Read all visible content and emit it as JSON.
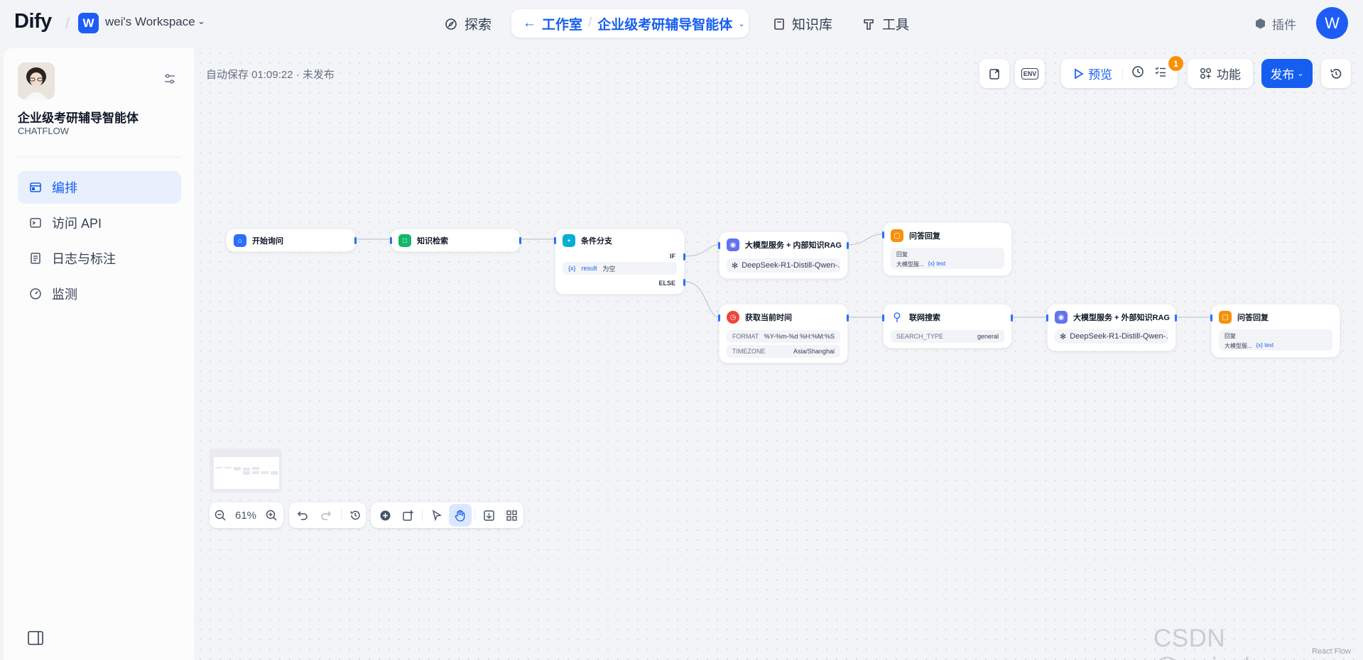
{
  "topbar": {
    "brand": "Dify",
    "workspace_initial": "W",
    "workspace_name": "wei's Workspace",
    "nav_explore": "探索",
    "nav_studio": "工作室",
    "nav_current_app": "企业级考研辅导智能体",
    "nav_knowledge": "知识库",
    "nav_tools": "工具",
    "plugins": "插件",
    "user_initial": "W"
  },
  "sidebar": {
    "app_name": "企业级考研辅导智能体",
    "app_type": "CHATFLOW",
    "items": [
      {
        "label": "编排",
        "icon": "layout-icon",
        "active": true
      },
      {
        "label": "访问 API",
        "icon": "terminal-icon",
        "active": false
      },
      {
        "label": "日志与标注",
        "icon": "log-icon",
        "active": false
      },
      {
        "label": "监测",
        "icon": "gauge-icon",
        "active": false
      }
    ]
  },
  "canvas": {
    "autosave": "自动保存 01:09:22 · 未发布",
    "toolbar": {
      "env_label": "ENV",
      "preview_label": "预览",
      "checklist_count": "1",
      "features_label": "功能",
      "publish_label": "发布"
    },
    "nodes": {
      "start": {
        "title": "开始询问"
      },
      "knowledge": {
        "title": "知识检索"
      },
      "ifelse": {
        "title": "条件分支",
        "if_label": "IF",
        "else_label": "ELSE",
        "cond_var_icon": "{x}",
        "cond_var": "result",
        "cond_op": "为空"
      },
      "llm_internal": {
        "title": "大模型服务 + 内部知识RAG",
        "model": "DeepSeek-R1-Distill-Qwen-..."
      },
      "answer1": {
        "title": "问答回复",
        "label": "回复",
        "source": "大模型服...",
        "var": "{x} text"
      },
      "time": {
        "title": "获取当前时间",
        "format_key": "FORMAT",
        "format_val": "%Y-%m-%d %H:%M:%S",
        "tz_key": "TIMEZONE",
        "tz_val": "Asia/Shanghai"
      },
      "search": {
        "title": "联网搜索",
        "type_key": "SEARCH_TYPE",
        "type_val": "general"
      },
      "llm_external": {
        "title": "大模型服务 + 外部知识RAG",
        "model": "DeepSeek-R1-Distill-Qwen-..."
      },
      "answer2": {
        "title": "问答回复",
        "label": "回复",
        "source": "大模型服...",
        "var": "{x} text"
      }
    },
    "zoom": "61%"
  },
  "watermark": "CSDN @wei_shuo",
  "react_flow": "React Flow",
  "colors": {
    "accent": "#155eef",
    "badge": "#f79009"
  }
}
